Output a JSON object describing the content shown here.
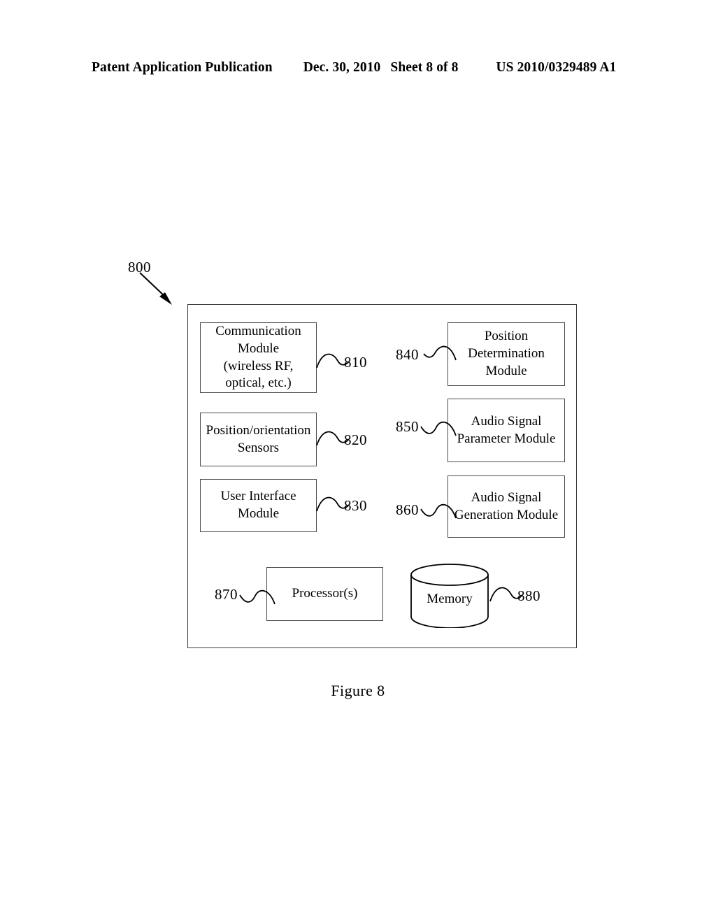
{
  "header": {
    "publication": "Patent Application Publication",
    "date": "Dec. 30, 2010",
    "sheet": "Sheet 8 of 8",
    "document_number": "US 2010/0329489 A1"
  },
  "figure": {
    "caption": "Figure 8",
    "system_ref": "800",
    "blocks": [
      {
        "ref": "810",
        "line1": "Communication",
        "line2": "Module",
        "line3": "(wireless RF,",
        "line4": "optical, etc.)"
      },
      {
        "ref": "820",
        "line1": "Position/orientation",
        "line2": "Sensors"
      },
      {
        "ref": "830",
        "line1": "User Interface",
        "line2": "Module"
      },
      {
        "ref": "840",
        "line1": "Position",
        "line2": "Determination",
        "line3": "Module"
      },
      {
        "ref": "850",
        "line1": "Audio Signal",
        "line2": "Parameter Module"
      },
      {
        "ref": "860",
        "line1": "Audio Signal",
        "line2": "Generation Module"
      },
      {
        "ref": "870",
        "line1": "Processor(s)"
      },
      {
        "ref": "880",
        "line1": "Memory"
      }
    ]
  }
}
